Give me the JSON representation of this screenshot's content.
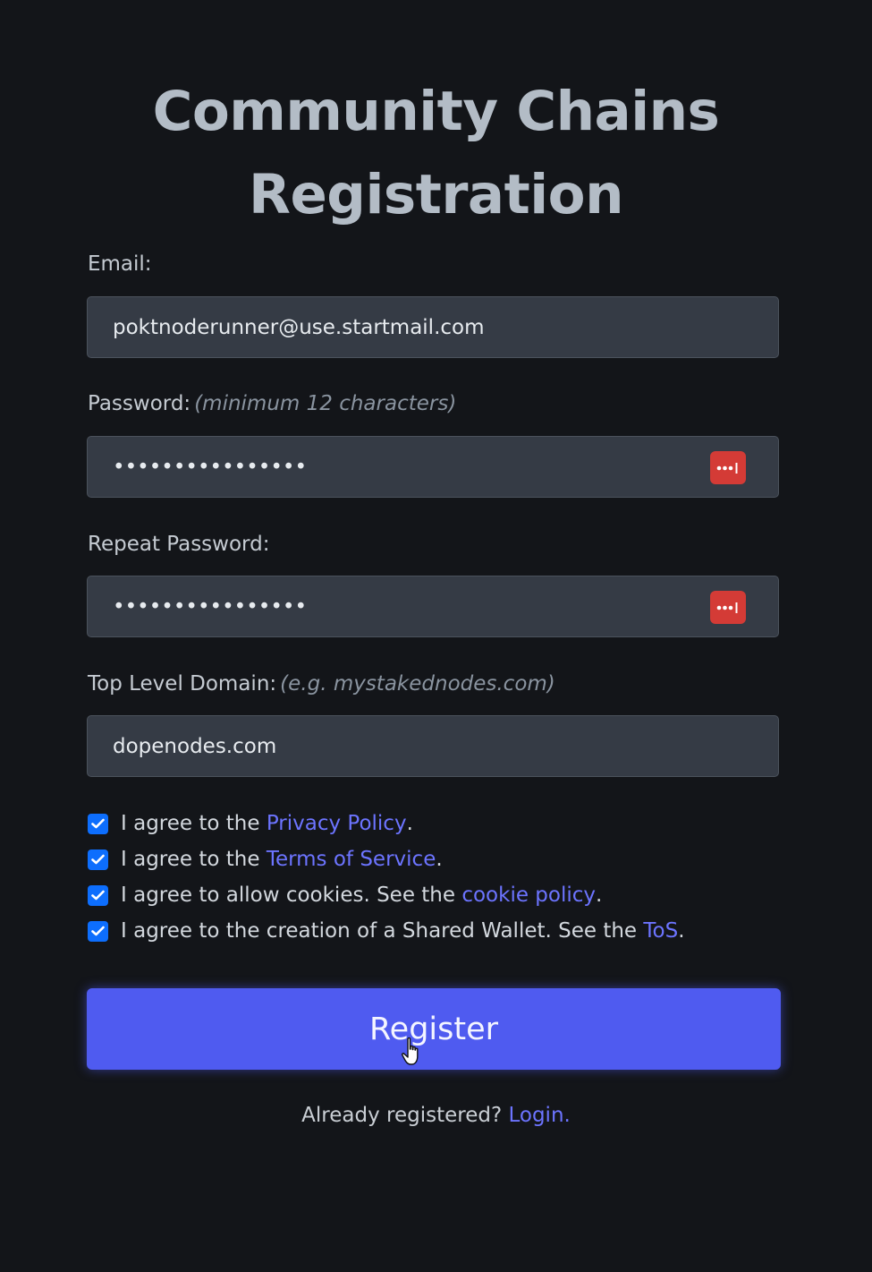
{
  "form": {
    "title_line1": "Community Chains",
    "title_line2": "Registration",
    "email": {
      "label": "Email:",
      "value": "poktnoderunner@use.startmail.com"
    },
    "password": {
      "label": "Password:",
      "hint": "(minimum 12 characters)",
      "value": "••••••••••••••••"
    },
    "repeat_password": {
      "label": "Repeat Password:",
      "value": "••••••••••••••••"
    },
    "domain": {
      "label": "Top Level Domain:",
      "hint": "(e.g. mystakednodes.com)",
      "value": "dopenodes.com"
    },
    "agreements": [
      {
        "text": "I agree to the ",
        "link": "Privacy Policy",
        "suffix": ".",
        "checked": true
      },
      {
        "text": "I agree to the ",
        "link": "Terms of Service",
        "suffix": ".",
        "checked": true
      },
      {
        "text": "I agree to allow cookies. See the ",
        "link": "cookie policy",
        "suffix": ".",
        "checked": true
      },
      {
        "text": "I agree to the creation of a Shared Wallet. See the ",
        "link": "ToS",
        "suffix": ".",
        "checked": true
      }
    ],
    "register_label": "Register",
    "footer_text": "Already registered? ",
    "login_link": "Login."
  },
  "icons": {
    "password_manager": "password-manager-icon",
    "checkbox": "checkmark-icon",
    "cursor": "hand-pointer-icon"
  },
  "colors": {
    "background": "#131519",
    "input_bg": "#353b45",
    "accent": "#4f5bf0",
    "link": "#6c74ff",
    "checkbox": "#0d6efd",
    "password_manager": "#d43b36"
  }
}
